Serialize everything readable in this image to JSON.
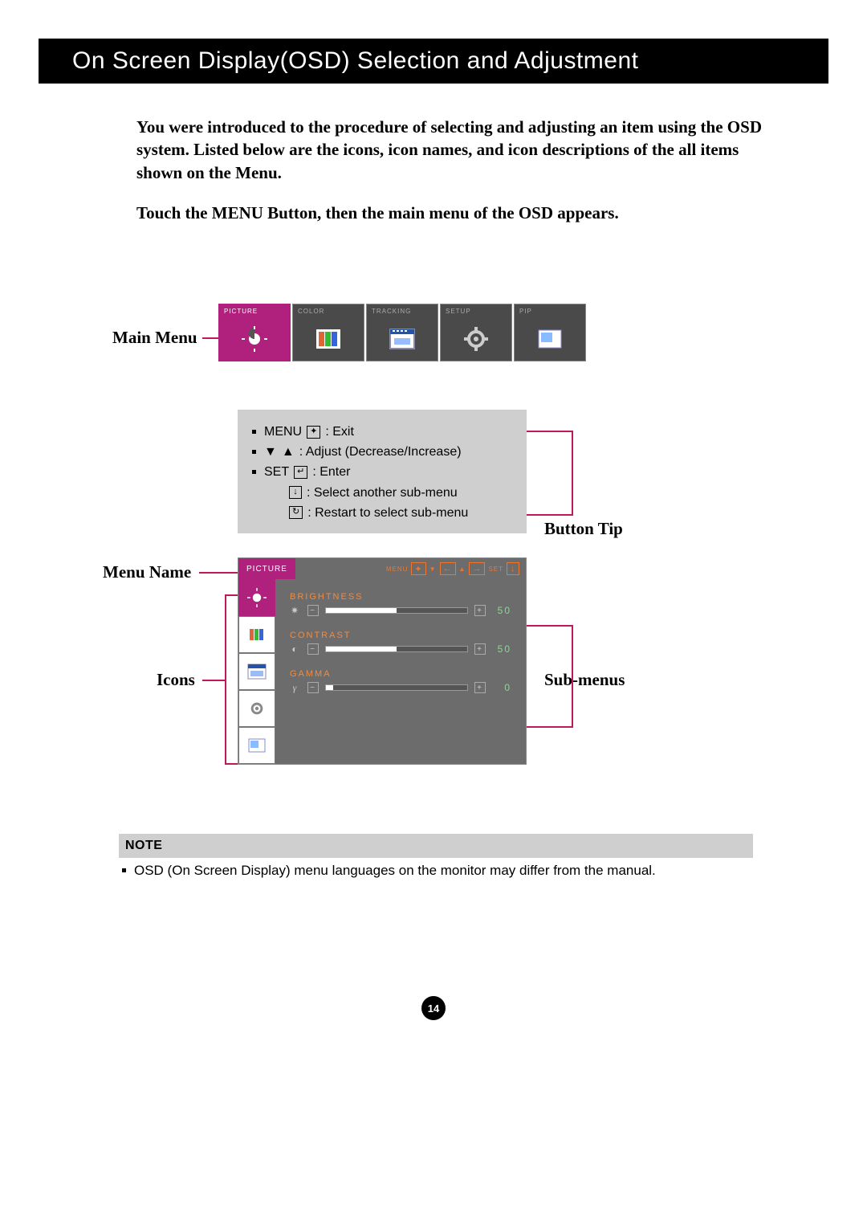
{
  "header": {
    "title": "On Screen Display(OSD) Selection and Adjustment"
  },
  "intro": {
    "p1": "You were introduced to the procedure of selecting and adjusting an item using the OSD system.  Listed below are the icons, icon names, and icon descriptions of the all items shown on the Menu.",
    "p2": "Touch the MENU Button, then the main menu of the OSD appears."
  },
  "labels": {
    "main_menu": "Main Menu",
    "menu_name": "Menu Name",
    "icons": "Icons",
    "button_tip": "Button Tip",
    "sub_menus": "Sub-menus"
  },
  "main_menu": {
    "items": [
      {
        "label": "PICTURE",
        "active": true
      },
      {
        "label": "COLOR",
        "active": false
      },
      {
        "label": "TRACKING",
        "active": false
      },
      {
        "label": "SETUP",
        "active": false
      },
      {
        "label": "PIP",
        "active": false
      }
    ]
  },
  "button_tips": {
    "menu_label": "MENU",
    "menu_desc": ": Exit",
    "adjust_desc": ": Adjust (Decrease/Increase)",
    "set_label": "SET",
    "set_desc": ": Enter",
    "down_desc": ": Select another sub-menu",
    "restart_desc": ": Restart to select sub-menu"
  },
  "submenu": {
    "menu_name": "PICTURE",
    "nav": {
      "menu": "MENU",
      "set": "SET"
    },
    "rows": [
      {
        "name": "BRIGHTNESS",
        "glyph": "✷",
        "value": "50",
        "fill": 50
      },
      {
        "name": "CONTRAST",
        "glyph": "◐",
        "value": "50",
        "fill": 50
      },
      {
        "name": "GAMMA",
        "glyph": "γ",
        "value": "0",
        "fill": 5
      }
    ]
  },
  "note": {
    "title": "NOTE",
    "body": "OSD (On Screen Display) menu languages on the monitor may differ from the manual."
  },
  "page": "14",
  "colors": {
    "magenta": "#b0207d",
    "callout": "#c0185b",
    "orange": "#f58a3c",
    "green_num": "#7fe08a"
  }
}
